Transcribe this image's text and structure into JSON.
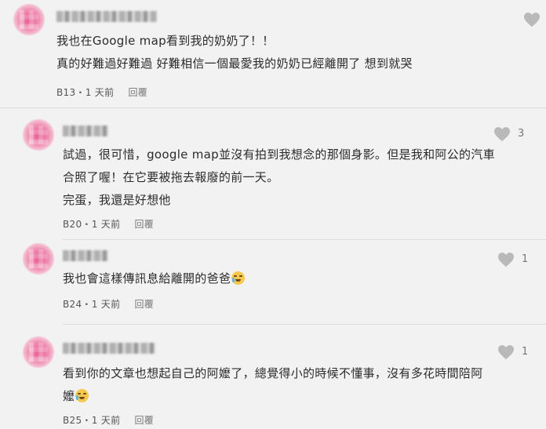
{
  "icons": {
    "like": "heart-icon",
    "emoji": "crying-face-emoji"
  },
  "colors": {
    "avatar": "#e8578d",
    "heart": "#b9b9b9",
    "background": "#f2f2f2"
  },
  "comments": [
    {
      "lines": [
        "我也在Google map看到我的奶奶了！！",
        "真的好難過好難過 好難相信一個最愛我的奶奶已經離開了 想到就哭"
      ],
      "floor": "B13",
      "time": "1 天前",
      "reply": "回覆",
      "likes": ""
    },
    {
      "lines": [
        "試過，很可惜，google map並沒有拍到我想念的那個身影。但是我和阿公的汽車",
        "合照了喔！在它要被拖去報廢的前一天。",
        "完蛋，我還是好想他"
      ],
      "floor": "B20",
      "time": "1 天前",
      "reply": "回覆",
      "likes": "3"
    },
    {
      "lines": [
        "我也會這樣傳訊息給離開的爸爸"
      ],
      "floor": "B24",
      "time": "1 天前",
      "reply": "回覆",
      "likes": "1"
    },
    {
      "lines": [
        "看到你的文章也想起自己的阿嬤了，總覺得小的時候不懂事，沒有多花時間陪阿",
        "嬤"
      ],
      "floor": "B25",
      "time": "1 天前",
      "reply": "回覆",
      "likes": "1"
    }
  ]
}
